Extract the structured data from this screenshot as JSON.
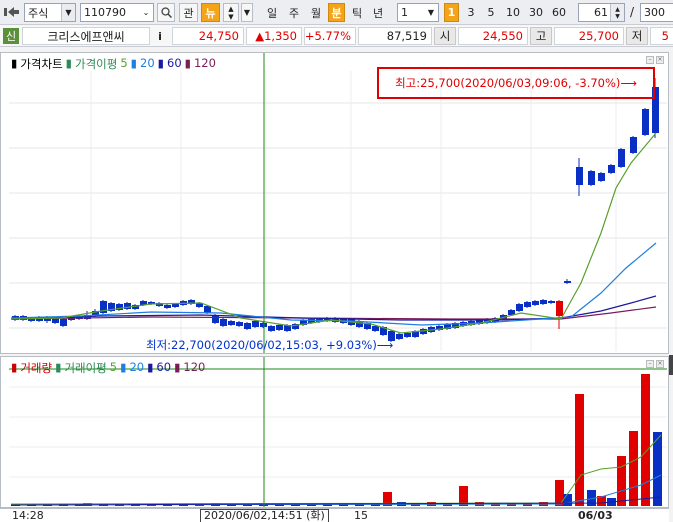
{
  "toolbar": {
    "market_select": "주식",
    "code_input": "110790",
    "btn_gwan": "관",
    "btn_new": "뉴",
    "periods": [
      "일",
      "주",
      "월",
      "분",
      "틱",
      "년"
    ],
    "period_active": "분",
    "interval_select": "1",
    "intervals": [
      "1",
      "3",
      "5",
      "10",
      "30",
      "60"
    ],
    "interval_active": "1",
    "count_input": "61",
    "total_input": "300"
  },
  "quote": {
    "tag": "신",
    "name": "크리스에프앤씨",
    "info_btn": "i",
    "price": "24,750",
    "change": "▲1,350",
    "change_pct": "+5.77%",
    "volume": "87,519",
    "open_label": "시",
    "open": "24,550",
    "high_label": "고",
    "high": "25,700",
    "low_label": "저",
    "low": "5"
  },
  "price_panel": {
    "legend": [
      {
        "text": "가격차트",
        "color": "#000000"
      },
      {
        "text": "가격이평",
        "color": "#2e8b57"
      },
      {
        "text": "5",
        "color": "#5aa02c"
      },
      {
        "text": "20",
        "color": "#1f7fe0"
      },
      {
        "text": "60",
        "color": "#1a1aa0"
      },
      {
        "text": "120",
        "color": "#7a1e5a"
      }
    ],
    "high_annotation": "최고:25,700(2020/06/03,09:06, -3.70%)⟶",
    "low_annotation": "최저:22,700(2020/06/02,15:03, +9.03%)⟶"
  },
  "volume_panel": {
    "legend": [
      {
        "text": "거래량",
        "color": "#cc0000"
      },
      {
        "text": "거래이평",
        "color": "#2e8b57"
      },
      {
        "text": "5",
        "color": "#5aa02c"
      },
      {
        "text": "20",
        "color": "#1f7fe0"
      },
      {
        "text": "60",
        "color": "#1a1aa0"
      },
      {
        "text": "120",
        "color": "#7a1e5a"
      }
    ]
  },
  "time_axis": {
    "start": "14:28",
    "cursor": "2020/06/02,14:51 (화)",
    "mid": "15",
    "date": "06/03"
  },
  "colors": {
    "up": "#e00000",
    "down": "#0a2fc4",
    "ma5": "#5aa02c",
    "ma20": "#1f7fe0",
    "ma60": "#1a1aa0",
    "ma120": "#7a1e5a",
    "crosshair": "#1a8a1a"
  }
}
